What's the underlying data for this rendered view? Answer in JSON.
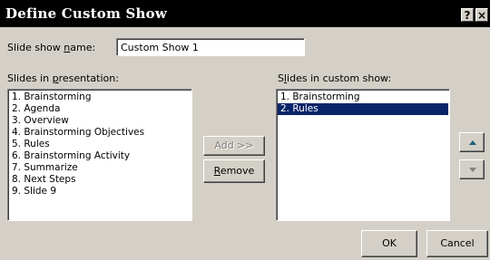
{
  "window": {
    "title": "Define Custom Show",
    "help_label": "?",
    "close_label": "×"
  },
  "show_name": {
    "label_pre": "Slide show ",
    "label_hotkey": "n",
    "label_post": "ame:",
    "value": "Custom Show 1"
  },
  "presentation_list": {
    "label_pre": "Slides in ",
    "label_hotkey": "p",
    "label_post": "resentation:",
    "items": [
      "1. Brainstorming",
      "2. Agenda",
      "3. Overview",
      "4. Brainstorming Objectives",
      "5. Rules",
      "6. Brainstorming Activity",
      "7. Summarize",
      "8. Next Steps",
      "9. Slide 9"
    ]
  },
  "custom_list": {
    "label_pre": "S",
    "label_hotkey": "l",
    "label_post": "ides in custom show:",
    "items": [
      "1. Brainstorming",
      "2. Rules"
    ],
    "selected_index": 1
  },
  "buttons": {
    "add": {
      "label": "Add >>",
      "enabled": false
    },
    "remove_hotkey": "R",
    "remove_rest": "emove",
    "move_up": "up-arrow-icon",
    "move_down": "down-arrow-icon",
    "ok": "OK",
    "cancel": "Cancel"
  },
  "colors": {
    "selection": "#0a246a",
    "face": "#d4d0c8",
    "move_up_arrow": "#1e5f74"
  }
}
